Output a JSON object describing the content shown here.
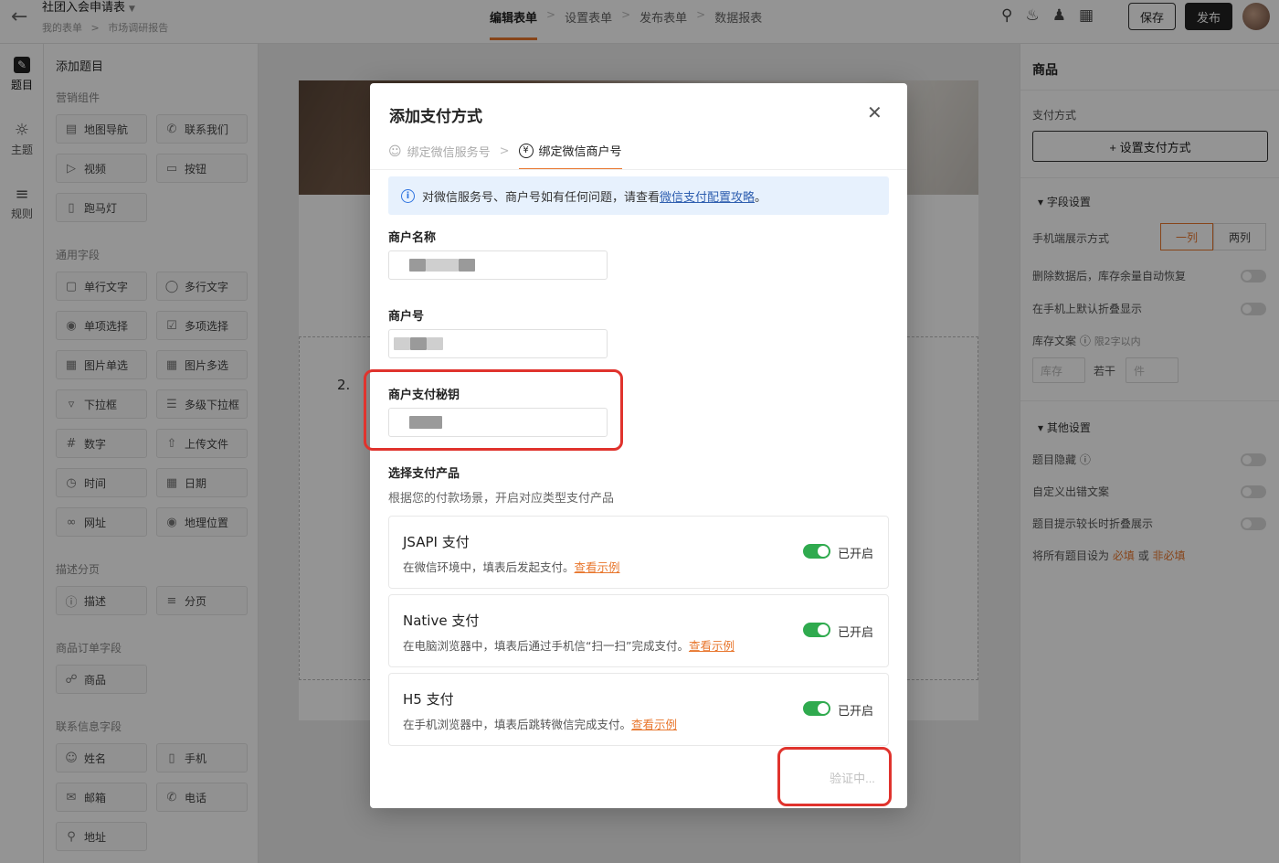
{
  "topbar": {
    "title": "社团入会申请表",
    "breadcrumb": [
      "我的表单",
      "市场调研报告"
    ],
    "breadcrumb_sep": ">",
    "steps": [
      "编辑表单",
      "设置表单",
      "发布表单",
      "数据报表"
    ],
    "step_sep": ">",
    "save_label": "保存",
    "publish_label": "发布",
    "icons": [
      "search-icon",
      "bell-icon",
      "add-user-icon",
      "apps-icon"
    ]
  },
  "rail": {
    "items": [
      {
        "label": "题目",
        "icon": "question-icon",
        "active": true
      },
      {
        "label": "主题",
        "icon": "palette-icon"
      },
      {
        "label": "规则",
        "icon": "rule-icon"
      }
    ]
  },
  "panel": {
    "title": "添加题目",
    "sections": {
      "marketing": "营销组件",
      "common": "通用字段",
      "desc": "描述分页",
      "goods": "商品订单字段",
      "contact": "联系信息字段"
    },
    "components": {
      "map": "地图导航",
      "contact": "联系我们",
      "video": "视频",
      "button": "按钮",
      "marquee": "跑马灯",
      "single_text": "单行文字",
      "multi_text": "多行文字",
      "single_choice": "单项选择",
      "multi_choice": "多项选择",
      "img_single": "图片单选",
      "img_multi": "图片多选",
      "dropdown": "下拉框",
      "multi_dropdown": "多级下拉框",
      "number": "数字",
      "upload": "上传文件",
      "time": "时间",
      "date": "日期",
      "url": "网址",
      "location": "地理位置",
      "describe": "描述",
      "paging": "分页",
      "product": "商品",
      "name": "姓名",
      "phone": "手机",
      "email": "邮箱",
      "tel": "电话",
      "address": "地址"
    }
  },
  "canvas": {
    "question_number": "2."
  },
  "right_panel": {
    "title": "商品",
    "pay_method_label": "支付方式",
    "set_pay_label": "+ 设置支付方式",
    "field_settings": "字段设置",
    "mobile_display": "手机端展示方式",
    "mobile_options": [
      "一列",
      "两列"
    ],
    "mobile_selected": "一列",
    "restore_stock": "删除数据后，库存余量自动恢复",
    "fold_default": "在手机上默认折叠显示",
    "stock_text": "库存文案",
    "stock_hint": "限2字以内",
    "stock_placeholder": "库存",
    "stock_middle": "若干",
    "stock_unit_placeholder": "件",
    "other_settings": "其他设置",
    "hide_question": "题目隐藏",
    "custom_error": "自定义出错文案",
    "fold_long_hint": "题目提示较长时折叠展示",
    "set_all_prefix": "将所有题目设为",
    "required": "必填",
    "or": "或",
    "not_required": "非必填"
  },
  "modal": {
    "title": "添加支付方式",
    "tabs": [
      "绑定微信服务号",
      "绑定微信商户号"
    ],
    "tab_sep": ">",
    "alert_text": "对微信服务号、商户号如有任何问题，请查看",
    "alert_link": "微信支付配置攻略",
    "alert_end": "。",
    "merchant_name_label": "商户名称",
    "merchant_id_label": "商户号",
    "merchant_key_label": "商户支付秘钥",
    "select_products_title": "选择支付产品",
    "select_products_desc": "根据您的付款场景，开启对应类型支付产品",
    "products": [
      {
        "title": "JSAPI 支付",
        "desc": "在微信环境中，填表后发起支付。",
        "link": "查看示例",
        "enabled": true,
        "status": "已开启"
      },
      {
        "title": "Native 支付",
        "desc": "在电脑浏览器中，填表后通过手机信“扫一扫”完成支付。",
        "link": "查看示例",
        "enabled": true,
        "status": "已开启"
      },
      {
        "title": "H5 支付",
        "desc": "在手机浏览器中，填表后跳转微信完成支付。",
        "link": "查看示例",
        "enabled": true,
        "status": "已开启"
      }
    ],
    "verify_label": "验证中..."
  },
  "colors": {
    "accent": "#e8772e",
    "toggle_on": "#2faa4e",
    "highlight": "#e0332d",
    "info_bg": "#e7f1fd"
  }
}
